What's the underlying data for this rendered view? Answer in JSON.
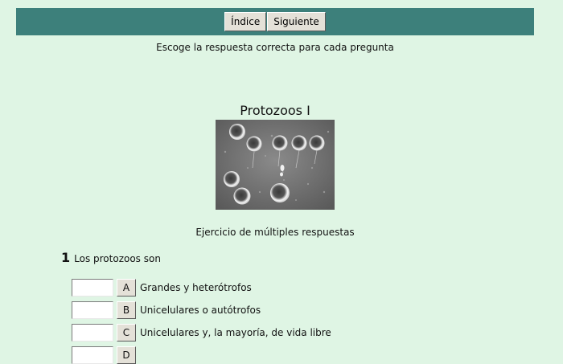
{
  "nav": {
    "index_label": "Índice",
    "next_label": "Siguiente"
  },
  "instructions": "Escoge la respuesta correcta para cada pregunta",
  "exercise": {
    "title": "Protozoos I",
    "image_icon": "protozoa-micrograph",
    "type_label": "Ejercicio de múltiples respuestas"
  },
  "question": {
    "number": "1",
    "text": "Los protozoos son",
    "options": [
      {
        "letter": "A",
        "text": "Grandes y heterótrofos",
        "answer": ""
      },
      {
        "letter": "B",
        "text": "Unicelulares o autótrofos",
        "answer": ""
      },
      {
        "letter": "C",
        "text": "Unicelulares y, la mayoría, de vida libre",
        "answer": ""
      },
      {
        "letter": "D",
        "text": "",
        "answer": ""
      }
    ]
  },
  "colors": {
    "background": "#dff5e4",
    "topbar": "#3d807b",
    "button": "#e4e1d8"
  }
}
